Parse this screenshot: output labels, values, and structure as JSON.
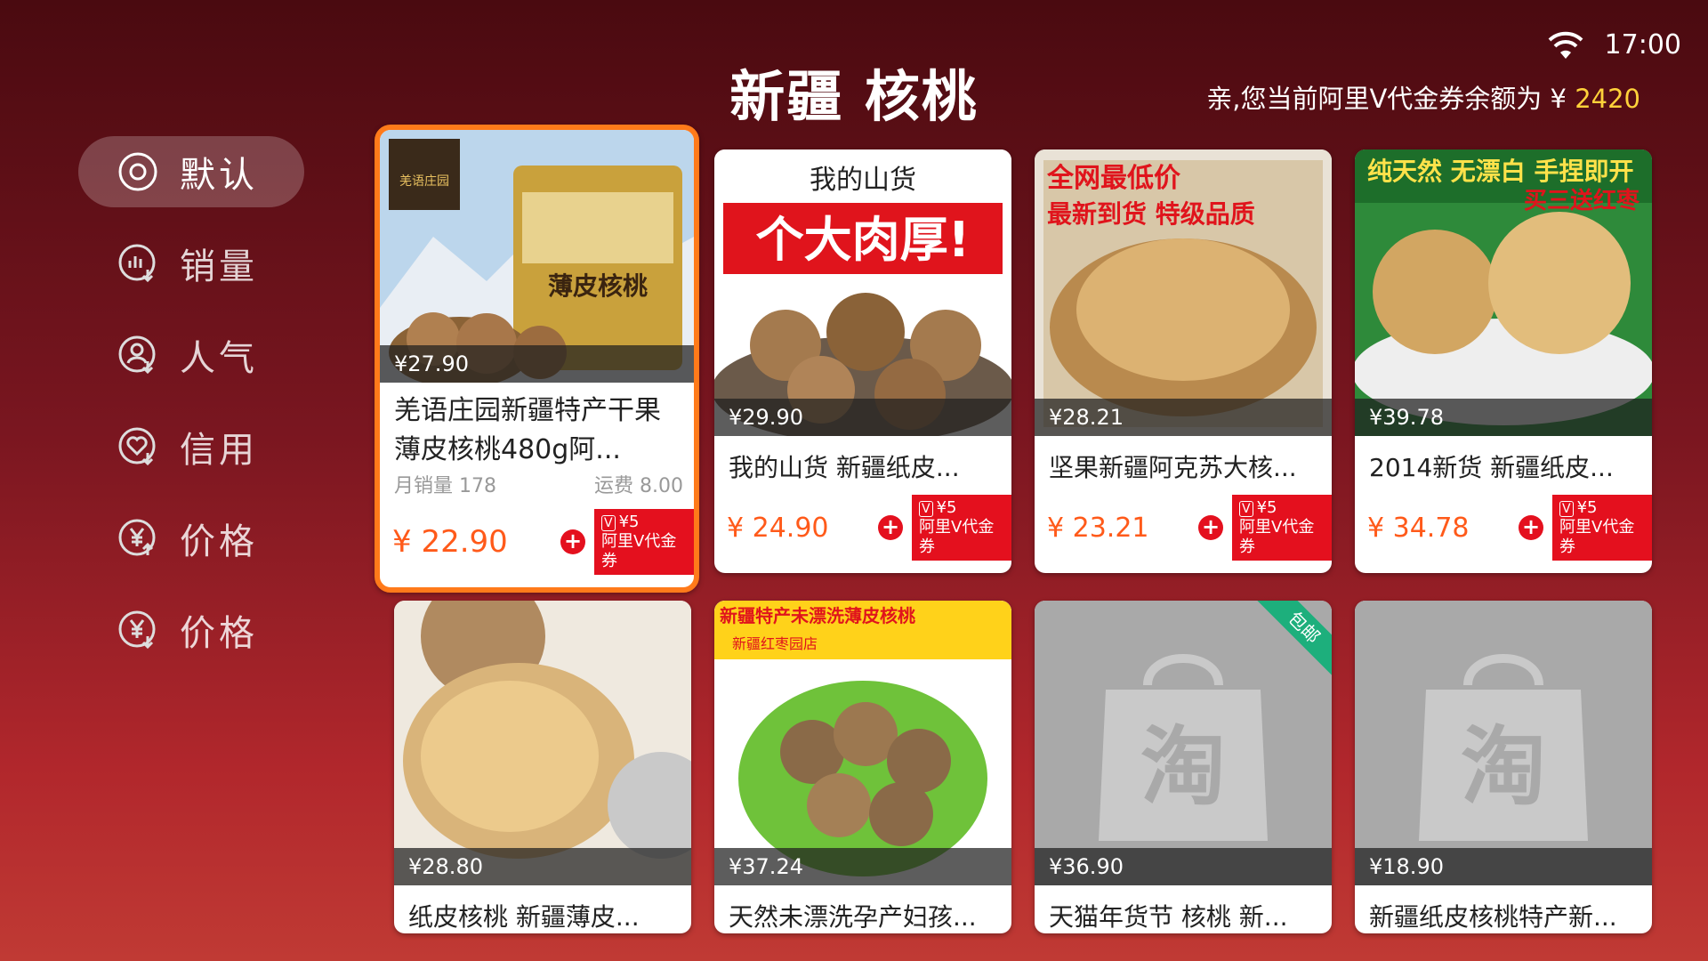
{
  "status": {
    "time": "17:00"
  },
  "title": "新疆 核桃",
  "balance": {
    "prefix": "亲,您当前阿里V代金券余额为 ¥ ",
    "amount": "2420"
  },
  "sidebar": [
    {
      "icon": "target-icon",
      "label": "默认",
      "active": true
    },
    {
      "icon": "sales-chart-icon",
      "label": "销量"
    },
    {
      "icon": "user-popularity-icon",
      "label": "人气"
    },
    {
      "icon": "heart-credit-icon",
      "label": "信用"
    },
    {
      "icon": "yuan-price-icon",
      "label": "价格"
    },
    {
      "icon": "yuan-price-icon",
      "label": "价格"
    }
  ],
  "products": [
    {
      "strip_price": "¥27.90",
      "name": "羌语庄园新疆特产干果薄皮核桃480g阿...",
      "monthly_sales": "月销量 178",
      "shipping": "运费 8.00",
      "final_price": "¥ 22.90",
      "coupon_amount": "¥5",
      "coupon_label": "阿里V代金券",
      "image_text": [
        "羌语庄园",
        "薄皮核桃"
      ]
    },
    {
      "strip_price": "¥29.90",
      "name": "我的山货 新疆纸皮...",
      "final_price": "¥ 24.90",
      "coupon_amount": "¥5",
      "coupon_label": "阿里V代金券",
      "image_text": [
        "我的山货",
        "个大肉厚!"
      ]
    },
    {
      "strip_price": "¥28.21",
      "name": "坚果新疆阿克苏大核...",
      "final_price": "¥ 23.21",
      "coupon_amount": "¥5",
      "coupon_label": "阿里V代金券",
      "image_text": [
        "全网最低价",
        "最新到货 特级品质"
      ]
    },
    {
      "strip_price": "¥39.78",
      "name": "2014新货 新疆纸皮...",
      "final_price": "¥ 34.78",
      "coupon_amount": "¥5",
      "coupon_label": "阿里V代金券",
      "image_text": [
        "纯天然 无漂白 手捏即开",
        "买三送红枣"
      ]
    },
    {
      "strip_price": "¥28.80",
      "name": "纸皮核桃 新疆薄皮..."
    },
    {
      "strip_price": "¥37.24",
      "name": "天然未漂洗孕产妇孩...",
      "image_text": [
        "新疆特产未漂洗薄皮核桃",
        "新疆红枣园店"
      ]
    },
    {
      "strip_price": "¥36.90",
      "name": "天猫年货节 核桃 新...",
      "badge": "包邮",
      "placeholder_glyph": "淘"
    },
    {
      "strip_price": "¥18.90",
      "name": "新疆纸皮核桃特产新...",
      "placeholder_glyph": "淘"
    }
  ],
  "colors": {
    "accent": "#ff7a1a",
    "coupon": "#e4101e",
    "price": "#ff5a1a",
    "balance": "#ffd23a"
  }
}
